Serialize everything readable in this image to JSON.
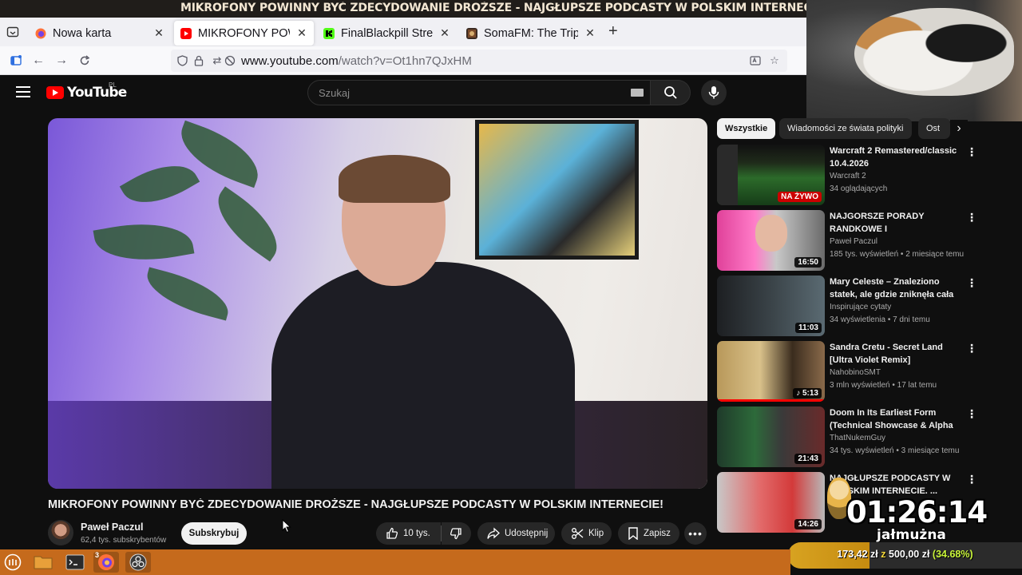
{
  "window": {
    "title": "MIKROFONY POWINNY BYĆ ZDECYDOWANIE DROŻSZE - NAJGŁUPSZE PODCASTY W POLSKIM INTERNECIE! - YouTube — Mozilla Firefox"
  },
  "tabs": [
    {
      "label": "Nowa karta",
      "icon": "firefox-icon",
      "active": false
    },
    {
      "label": "MIKROFONY POWINNY BYĆ ZDECYDOWANIE DROŻSZE",
      "icon": "youtube-icon",
      "active": true
    },
    {
      "label": "FinalBlackpill Stream",
      "icon": "kick-icon",
      "active": false
    },
    {
      "label": "SomaFM: The Trip Sc",
      "icon": "somafm-icon",
      "active": false
    }
  ],
  "navbar": {
    "url_host": "www.youtube.com",
    "url_path": "/watch?v=Ot1hn7QJxHM"
  },
  "youtube": {
    "logo_text": "YouTube",
    "country_code": "PL",
    "search_placeholder": "Szukaj"
  },
  "video": {
    "title": "MIKROFONY POWINNY BYĆ ZDECYDOWANIE DROŻSZE - NAJGŁUPSZE PODCASTY W POLSKIM INTERNECIE!",
    "channel": "Paweł Paczul",
    "subscribers": "62,4 tys. subskrybentów",
    "subscribe_label": "Subskrybuj",
    "likes": "10 tys.",
    "share_label": "Udostępnij",
    "clip_label": "Klip",
    "save_label": "Zapisz"
  },
  "chips": [
    "Wszystkie",
    "Wiadomości ze świata polityki",
    "Ost"
  ],
  "recommendations": [
    {
      "title": "Warcraft 2 Remastered/classic 10.4.2026",
      "channel": "Warcraft 2",
      "views": "34 oglądających",
      "badge": "NA ŻYWO",
      "live": true,
      "progress": 0
    },
    {
      "title": "NAJGORSZE PORADY RANDKOWE I NAJDZIWNIEJSZE...",
      "channel": "Paweł Paczul",
      "views": "185 tys. wyświetleń • 2 miesiące temu",
      "badge": "16:50",
      "live": false,
      "progress": 0
    },
    {
      "title": "Mary Celeste – Znaleziono statek, ale gdzie zniknęła cała ...",
      "channel": "Inspirujące cytaty",
      "views": "34 wyświetlenia • 7 dni temu",
      "badge": "11:03",
      "live": false,
      "progress": 0
    },
    {
      "title": "Sandra Cretu - Secret Land [Ultra Violet Remix]",
      "channel": "NahobinoSMT",
      "views": "3 mln wyświetleń • 17 lat temu",
      "badge": "♪ 5:13",
      "live": false,
      "progress": 1.0
    },
    {
      "title": "Doom In Its Earliest Form (Technical Showcase & Alpha ...",
      "channel": "ThatNukemGuy",
      "views": "34 tys. wyświetleń • 3 miesiące temu",
      "badge": "21:43",
      "live": false,
      "progress": 0
    },
    {
      "title": "NAJGŁUPSZE PODCASTY W POLSKIM INTERNECIE. ...",
      "channel": "",
      "views": "",
      "badge": "14:26",
      "live": false,
      "progress": 0
    }
  ],
  "overlay": {
    "timer": "01:26:14",
    "timer_label": "jałmużna",
    "donation_amount": "173,42 zł",
    "donation_sep": "z",
    "donation_goal": "500,00 zł",
    "donation_percent": "(34.68%)",
    "donation_fraction": 0.3468
  },
  "taskbar": {
    "items": [
      "menu-icon",
      "files-icon",
      "terminal-icon",
      "firefox-icon",
      "obs-icon"
    ],
    "firefox_badge": "3"
  },
  "colors": {
    "youtube_red": "#ff0000",
    "taskbar": "#c56a1c",
    "donation_fill": "#d8a321"
  }
}
